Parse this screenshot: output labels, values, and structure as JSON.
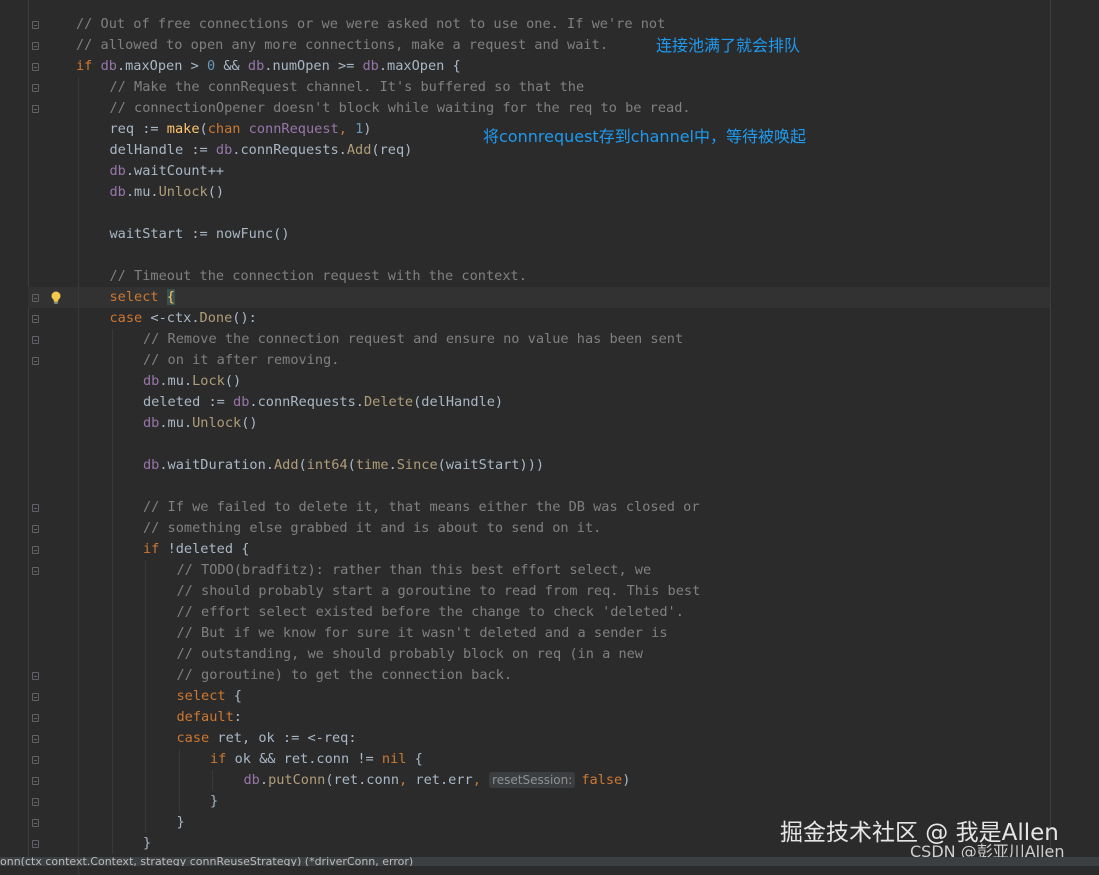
{
  "colors": {
    "background": "#2b2b2b",
    "comment": "#808080",
    "keyword": "#cc7832",
    "identifier": "#a9b7c6",
    "field": "#9876aa",
    "function": "#ffc66d",
    "method": "#b09d79",
    "number": "#6897bb",
    "annotation": "#1e9af0"
  },
  "editor": {
    "lines": [
      {
        "indent": 0,
        "tokens": [
          {
            "t": "// Out of free connections or we were asked not to use one. If we're not",
            "c": "comment"
          }
        ]
      },
      {
        "indent": 0,
        "tokens": [
          {
            "t": "// allowed to open any more connections, make a request and wait.",
            "c": "comment"
          }
        ]
      },
      {
        "indent": 0,
        "tokens": [
          {
            "t": "if ",
            "c": "keyword"
          },
          {
            "t": "db",
            "c": "field"
          },
          {
            "t": ".maxOpen > ",
            "c": "identifier"
          },
          {
            "t": "0",
            "c": "number"
          },
          {
            "t": " && ",
            "c": "identifier"
          },
          {
            "t": "db",
            "c": "field"
          },
          {
            "t": ".numOpen >= ",
            "c": "identifier"
          },
          {
            "t": "db",
            "c": "field"
          },
          {
            "t": ".maxOpen {",
            "c": "identifier"
          }
        ]
      },
      {
        "indent": 1,
        "tokens": [
          {
            "t": "// Make the connRequest channel. It's buffered so that the",
            "c": "comment"
          }
        ]
      },
      {
        "indent": 1,
        "tokens": [
          {
            "t": "// connectionOpener doesn't block while waiting for the req to be read.",
            "c": "comment"
          }
        ]
      },
      {
        "indent": 1,
        "tokens": [
          {
            "t": "req := ",
            "c": "identifier"
          },
          {
            "t": "make",
            "c": "function"
          },
          {
            "t": "(",
            "c": "identifier"
          },
          {
            "t": "chan ",
            "c": "keyword"
          },
          {
            "t": "connRequest",
            "c": "field"
          },
          {
            "t": ", ",
            "c": "keyword"
          },
          {
            "t": "1",
            "c": "number"
          },
          {
            "t": ")",
            "c": "identifier"
          }
        ]
      },
      {
        "indent": 1,
        "tokens": [
          {
            "t": "delHandle := ",
            "c": "identifier"
          },
          {
            "t": "db",
            "c": "field"
          },
          {
            "t": ".connRequests.",
            "c": "identifier"
          },
          {
            "t": "Add",
            "c": "method"
          },
          {
            "t": "(req)",
            "c": "identifier"
          }
        ]
      },
      {
        "indent": 1,
        "tokens": [
          {
            "t": "db",
            "c": "field"
          },
          {
            "t": ".waitCount++",
            "c": "identifier"
          }
        ]
      },
      {
        "indent": 1,
        "tokens": [
          {
            "t": "db",
            "c": "field"
          },
          {
            "t": ".mu.",
            "c": "identifier"
          },
          {
            "t": "Unlock",
            "c": "method"
          },
          {
            "t": "()",
            "c": "identifier"
          }
        ]
      },
      {
        "indent": 1,
        "tokens": []
      },
      {
        "indent": 1,
        "tokens": [
          {
            "t": "waitStart := nowFunc()",
            "c": "identifier"
          }
        ]
      },
      {
        "indent": 1,
        "tokens": []
      },
      {
        "indent": 1,
        "tokens": [
          {
            "t": "// Timeout the connection request with the context.",
            "c": "comment"
          }
        ]
      },
      {
        "indent": 1,
        "tokens": [
          {
            "t": "select ",
            "c": "keyword"
          },
          {
            "t": "{",
            "c": "function"
          }
        ]
      },
      {
        "indent": 1,
        "tokens": [
          {
            "t": "case ",
            "c": "keyword"
          },
          {
            "t": "<-ctx.",
            "c": "identifier"
          },
          {
            "t": "Done",
            "c": "method"
          },
          {
            "t": "():",
            "c": "identifier"
          }
        ]
      },
      {
        "indent": 2,
        "tokens": [
          {
            "t": "// Remove the connection request and ensure no value has been sent",
            "c": "comment"
          }
        ]
      },
      {
        "indent": 2,
        "tokens": [
          {
            "t": "// on it after removing.",
            "c": "comment"
          }
        ]
      },
      {
        "indent": 2,
        "tokens": [
          {
            "t": "db",
            "c": "field"
          },
          {
            "t": ".mu.",
            "c": "identifier"
          },
          {
            "t": "Lock",
            "c": "method"
          },
          {
            "t": "()",
            "c": "identifier"
          }
        ]
      },
      {
        "indent": 2,
        "tokens": [
          {
            "t": "deleted := ",
            "c": "identifier"
          },
          {
            "t": "db",
            "c": "field"
          },
          {
            "t": ".connRequests.",
            "c": "identifier"
          },
          {
            "t": "Delete",
            "c": "method"
          },
          {
            "t": "(delHandle)",
            "c": "identifier"
          }
        ]
      },
      {
        "indent": 2,
        "tokens": [
          {
            "t": "db",
            "c": "field"
          },
          {
            "t": ".mu.",
            "c": "identifier"
          },
          {
            "t": "Unlock",
            "c": "method"
          },
          {
            "t": "()",
            "c": "identifier"
          }
        ]
      },
      {
        "indent": 2,
        "tokens": []
      },
      {
        "indent": 2,
        "tokens": [
          {
            "t": "db",
            "c": "field"
          },
          {
            "t": ".waitDuration.",
            "c": "identifier"
          },
          {
            "t": "Add",
            "c": "method"
          },
          {
            "t": "(",
            "c": "identifier"
          },
          {
            "t": "int64",
            "c": "method"
          },
          {
            "t": "(",
            "c": "identifier"
          },
          {
            "t": "time",
            "c": "method"
          },
          {
            "t": ".",
            "c": "identifier"
          },
          {
            "t": "Since",
            "c": "method"
          },
          {
            "t": "(waitStart)))",
            "c": "identifier"
          }
        ]
      },
      {
        "indent": 2,
        "tokens": []
      },
      {
        "indent": 2,
        "tokens": [
          {
            "t": "// If we failed to delete it, that means either the DB was closed or",
            "c": "comment"
          }
        ]
      },
      {
        "indent": 2,
        "tokens": [
          {
            "t": "// something else grabbed it and is about to send on it.",
            "c": "comment"
          }
        ]
      },
      {
        "indent": 2,
        "tokens": [
          {
            "t": "if ",
            "c": "keyword"
          },
          {
            "t": "!deleted {",
            "c": "identifier"
          }
        ]
      },
      {
        "indent": 3,
        "tokens": [
          {
            "t": "// TODO(bradfitz): rather than this best effort select, we",
            "c": "comment"
          }
        ]
      },
      {
        "indent": 3,
        "tokens": [
          {
            "t": "// should probably start a goroutine to read from req. This best",
            "c": "comment"
          }
        ]
      },
      {
        "indent": 3,
        "tokens": [
          {
            "t": "// effort select existed before the change to check 'deleted'.",
            "c": "comment"
          }
        ]
      },
      {
        "indent": 3,
        "tokens": [
          {
            "t": "// But if we know for sure it wasn't deleted and a sender is",
            "c": "comment"
          }
        ]
      },
      {
        "indent": 3,
        "tokens": [
          {
            "t": "// outstanding, we should probably block on req (in a new",
            "c": "comment"
          }
        ]
      },
      {
        "indent": 3,
        "tokens": [
          {
            "t": "// goroutine) to get the connection back.",
            "c": "comment"
          }
        ]
      },
      {
        "indent": 3,
        "tokens": [
          {
            "t": "select ",
            "c": "keyword"
          },
          {
            "t": "{",
            "c": "identifier"
          }
        ]
      },
      {
        "indent": 3,
        "tokens": [
          {
            "t": "default",
            "c": "keyword"
          },
          {
            "t": ":",
            "c": "identifier"
          }
        ]
      },
      {
        "indent": 3,
        "tokens": [
          {
            "t": "case ",
            "c": "keyword"
          },
          {
            "t": "ret, ok := <-req:",
            "c": "identifier"
          }
        ]
      },
      {
        "indent": 4,
        "tokens": [
          {
            "t": "if ",
            "c": "keyword"
          },
          {
            "t": "ok && ret.conn != ",
            "c": "identifier"
          },
          {
            "t": "nil ",
            "c": "keyword"
          },
          {
            "t": "{",
            "c": "identifier"
          }
        ]
      },
      {
        "indent": 5,
        "tokens": [
          {
            "t": "db",
            "c": "field"
          },
          {
            "t": ".",
            "c": "identifier"
          },
          {
            "t": "putConn",
            "c": "method"
          },
          {
            "t": "(ret.conn",
            "c": "identifier"
          },
          {
            "t": ", ",
            "c": "keyword"
          },
          {
            "t": "ret.err",
            "c": "identifier"
          },
          {
            "t": ", ",
            "c": "keyword"
          },
          {
            "t": "resetSession:",
            "c": "hint"
          },
          {
            "t": "false",
            "c": "keyword"
          },
          {
            "t": ")",
            "c": "identifier"
          }
        ]
      },
      {
        "indent": 4,
        "tokens": [
          {
            "t": "}",
            "c": "identifier"
          }
        ]
      },
      {
        "indent": 3,
        "tokens": [
          {
            "t": "}",
            "c": "identifier"
          }
        ]
      },
      {
        "indent": 2,
        "tokens": [
          {
            "t": "}",
            "c": "identifier"
          }
        ]
      }
    ]
  },
  "annotations": {
    "pool_full": "连接池满了就会排队",
    "store_request": "将connrequest存到channel中，等待被唤起"
  },
  "watermark": {
    "site": "掘金技术社区 @ 我是Allen",
    "csdn": "CSDN @彭亚川Allen"
  },
  "status_bar": {
    "text": "onn(ctx context.Context, strategy connReuseStrategy) (*driverConn, error)"
  },
  "icons": {
    "bulb": "lightbulb-icon",
    "fold": "fold-marker-icon"
  }
}
